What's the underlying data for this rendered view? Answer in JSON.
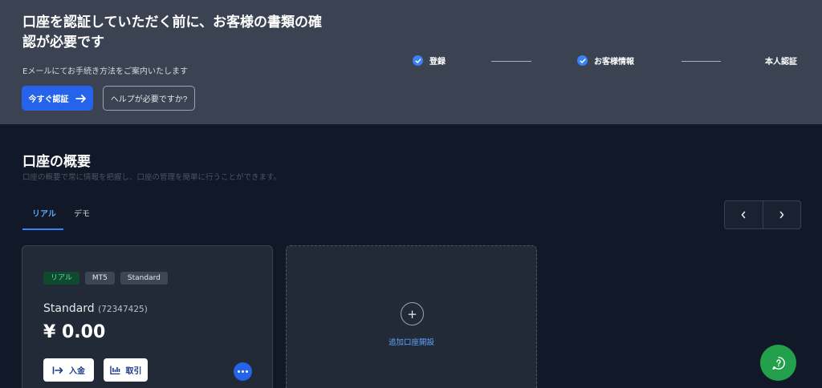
{
  "banner": {
    "title": "口座を認証していただく前に、お客様の書類の確認が必要です",
    "subtitle": "Eメールにてお手続き方法をご案内いたします",
    "verify_button": "今すぐ認証",
    "help_button": "ヘルプが必要ですか?",
    "steps": [
      {
        "label": "登録",
        "done": true
      },
      {
        "label": "お客様情報",
        "done": true
      },
      {
        "label": "本人認証",
        "done": false
      }
    ]
  },
  "overview": {
    "title": "口座の概要",
    "subtitle": "口座の概要で常に情報を把握し、口座の管理を簡単に行うことができます。"
  },
  "tabs": [
    {
      "label": "リアル",
      "active": true
    },
    {
      "label": "デモ",
      "active": false
    }
  ],
  "account_card": {
    "badges": [
      "リアル",
      "MT5",
      "Standard"
    ],
    "name": "Standard",
    "number": "(72347425)",
    "balance": "¥ 0.00",
    "deposit_label": "入金",
    "trade_label": "取引"
  },
  "add_account": {
    "label": "追加口座開設"
  },
  "colors": {
    "accent": "#2563eb",
    "banner_bg": "#3b4353",
    "page_bg": "#111827",
    "card_bg": "#222a37",
    "real_badge": "#0f4a2f",
    "help_fab": "#22a04b"
  }
}
